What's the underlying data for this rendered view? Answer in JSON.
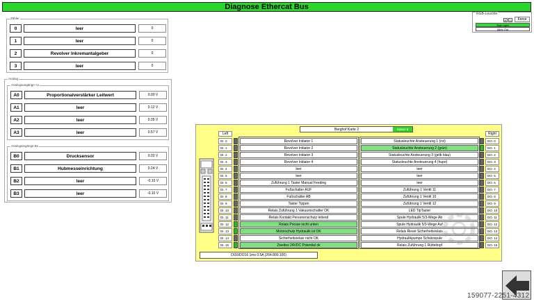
{
  "header": {
    "title": "Diagnose Ethercat Bus"
  },
  "rgb": {
    "label": "RGB-Leuchte",
    "force_label": "Force",
    "r": "R",
    "g": "G",
    "b": "B",
    "light_label": "Rgb Light",
    "alles_out": "Alles Out"
  },
  "zaehler": {
    "label": "Zähler",
    "rows": [
      {
        "idx": "0",
        "name": "leer",
        "value": "0"
      },
      {
        "idx": "1",
        "name": "leer",
        "value": "0"
      },
      {
        "idx": "2",
        "name": "Revolver Inkremantalgeber",
        "value": "0"
      },
      {
        "idx": "3",
        "name": "leer",
        "value": "0"
      }
    ]
  },
  "analog": {
    "label": "Analog",
    "out_label": "Analogausgänge Ax",
    "out_rows": [
      {
        "idx": "A0",
        "name": "Proportionalverstärker Leitwert",
        "value": "0.00 V"
      },
      {
        "idx": "A1",
        "name": "leer",
        "value": "0.12 V"
      },
      {
        "idx": "A2",
        "name": "leer",
        "value": "0.35 V"
      },
      {
        "idx": "A3",
        "name": "leer",
        "value": "0.57 V"
      }
    ],
    "in_label": "Analogeingänge Bx",
    "in_rows": [
      {
        "idx": "B0",
        "name": "Drucksensor",
        "value": "0.02 V"
      },
      {
        "idx": "B1",
        "name": "Hubmesseinrichtung",
        "value": "0.24 V"
      },
      {
        "idx": "B2",
        "name": "leer",
        "value": "-0.10 V"
      },
      {
        "idx": "B3",
        "name": "leer",
        "value": "-0.10 V"
      }
    ]
  },
  "ethercat": {
    "card_name": "Berghof Karte 2",
    "status": "Status 8",
    "left_label": "Left",
    "right_label": "Right",
    "footer": "DI16/DO16 1ms 0.5A (264.800.100)",
    "inputs": [
      {
        "id": "DI.  0",
        "name": "Revolver Initiator 1",
        "on": false
      },
      {
        "id": "DI.  1",
        "name": "Revolver Initiator 2",
        "on": false
      },
      {
        "id": "DI.  2",
        "name": "Revolver Initiator 3",
        "on": false
      },
      {
        "id": "DI.  3",
        "name": "Revolver Initiator 4",
        "on": false
      },
      {
        "id": "DI.  4",
        "name": "leer",
        "on": false
      },
      {
        "id": "DI.  5",
        "name": "leer",
        "on": false
      },
      {
        "id": "DI.  6",
        "name": "Zuführung 1 Taster Manual Feeding",
        "on": false
      },
      {
        "id": "DI.  7",
        "name": "Fußschalter AUF",
        "on": false
      },
      {
        "id": "DI.  8",
        "name": "Fußschalter AB",
        "on": false
      },
      {
        "id": "DI.  9",
        "name": "Taster Tippen",
        "on": false
      },
      {
        "id": "DI. 10",
        "name": "Relais Zuführung 1 Vakuumschalter OK",
        "on": false
      },
      {
        "id": "DI. 11",
        "name": "Relais Kontakt Personenschutz leitend",
        "on": false
      },
      {
        "id": "DI. 12",
        "name": "Relais Presse nicht unten",
        "on": true
      },
      {
        "id": "DI. 13",
        "name": "Motorschutz Hydraulik ist OK",
        "on": true
      },
      {
        "id": "DI. 14",
        "name": "Sicherheitsrelais nicht OK",
        "on": false
      },
      {
        "id": "DI. 15",
        "name": "Zweites 24VDC Potential ok",
        "on": true
      }
    ],
    "outputs": [
      {
        "id": "DO.  0",
        "name": "Statusleuchte Ansteuerung 1 (rot)",
        "on": false
      },
      {
        "id": "DO.  1",
        "name": "Statusleuchte Ansteuerung 2 (grün)",
        "on": true
      },
      {
        "id": "DO.  2",
        "name": "Statusleuchte Ansteuerung 3 (gelb blau)",
        "on": false
      },
      {
        "id": "DO.  3",
        "name": "Statusleuchte Ansteuerung 4 (hupe)",
        "on": false
      },
      {
        "id": "DO.  4",
        "name": "leer",
        "on": false
      },
      {
        "id": "DO.  5",
        "name": "leer",
        "on": false
      },
      {
        "id": "DO.  6",
        "name": "leer",
        "on": false
      },
      {
        "id": "DO.  7",
        "name": "Zuführung 1 Ventil 11",
        "on": false
      },
      {
        "id": "DO.  8",
        "name": "Zuführung 1 Ventil 10",
        "on": false
      },
      {
        "id": "DO.  9",
        "name": "Zuführung 1 Ventil 12",
        "on": false
      },
      {
        "id": "DO. 10",
        "name": "LED TipTaster",
        "on": false
      },
      {
        "id": "DO. 11",
        "name": "Spule Hydraulik 5/3-Wege Ab",
        "on": false
      },
      {
        "id": "DO. 12",
        "name": "Spule Hydraulik 5/3-Wege Auf",
        "on": false
      },
      {
        "id": "DO. 13",
        "name": "Relais Reset Sicherheitsrelais",
        "on": false
      },
      {
        "id": "DO. 14",
        "name": "Hydraulikpumpe Schützspule",
        "on": false
      },
      {
        "id": "DO. 15",
        "name": "Relais Zuführung 1 Rütteltopf",
        "on": false
      }
    ]
  },
  "nav": {
    "back": "back-arrow-icon"
  },
  "reference": "159077-2251-4312",
  "colors": {
    "accent_green": "#2bd62b",
    "panel_yellow": "#ffff88",
    "active_green": "#7fe07f"
  }
}
